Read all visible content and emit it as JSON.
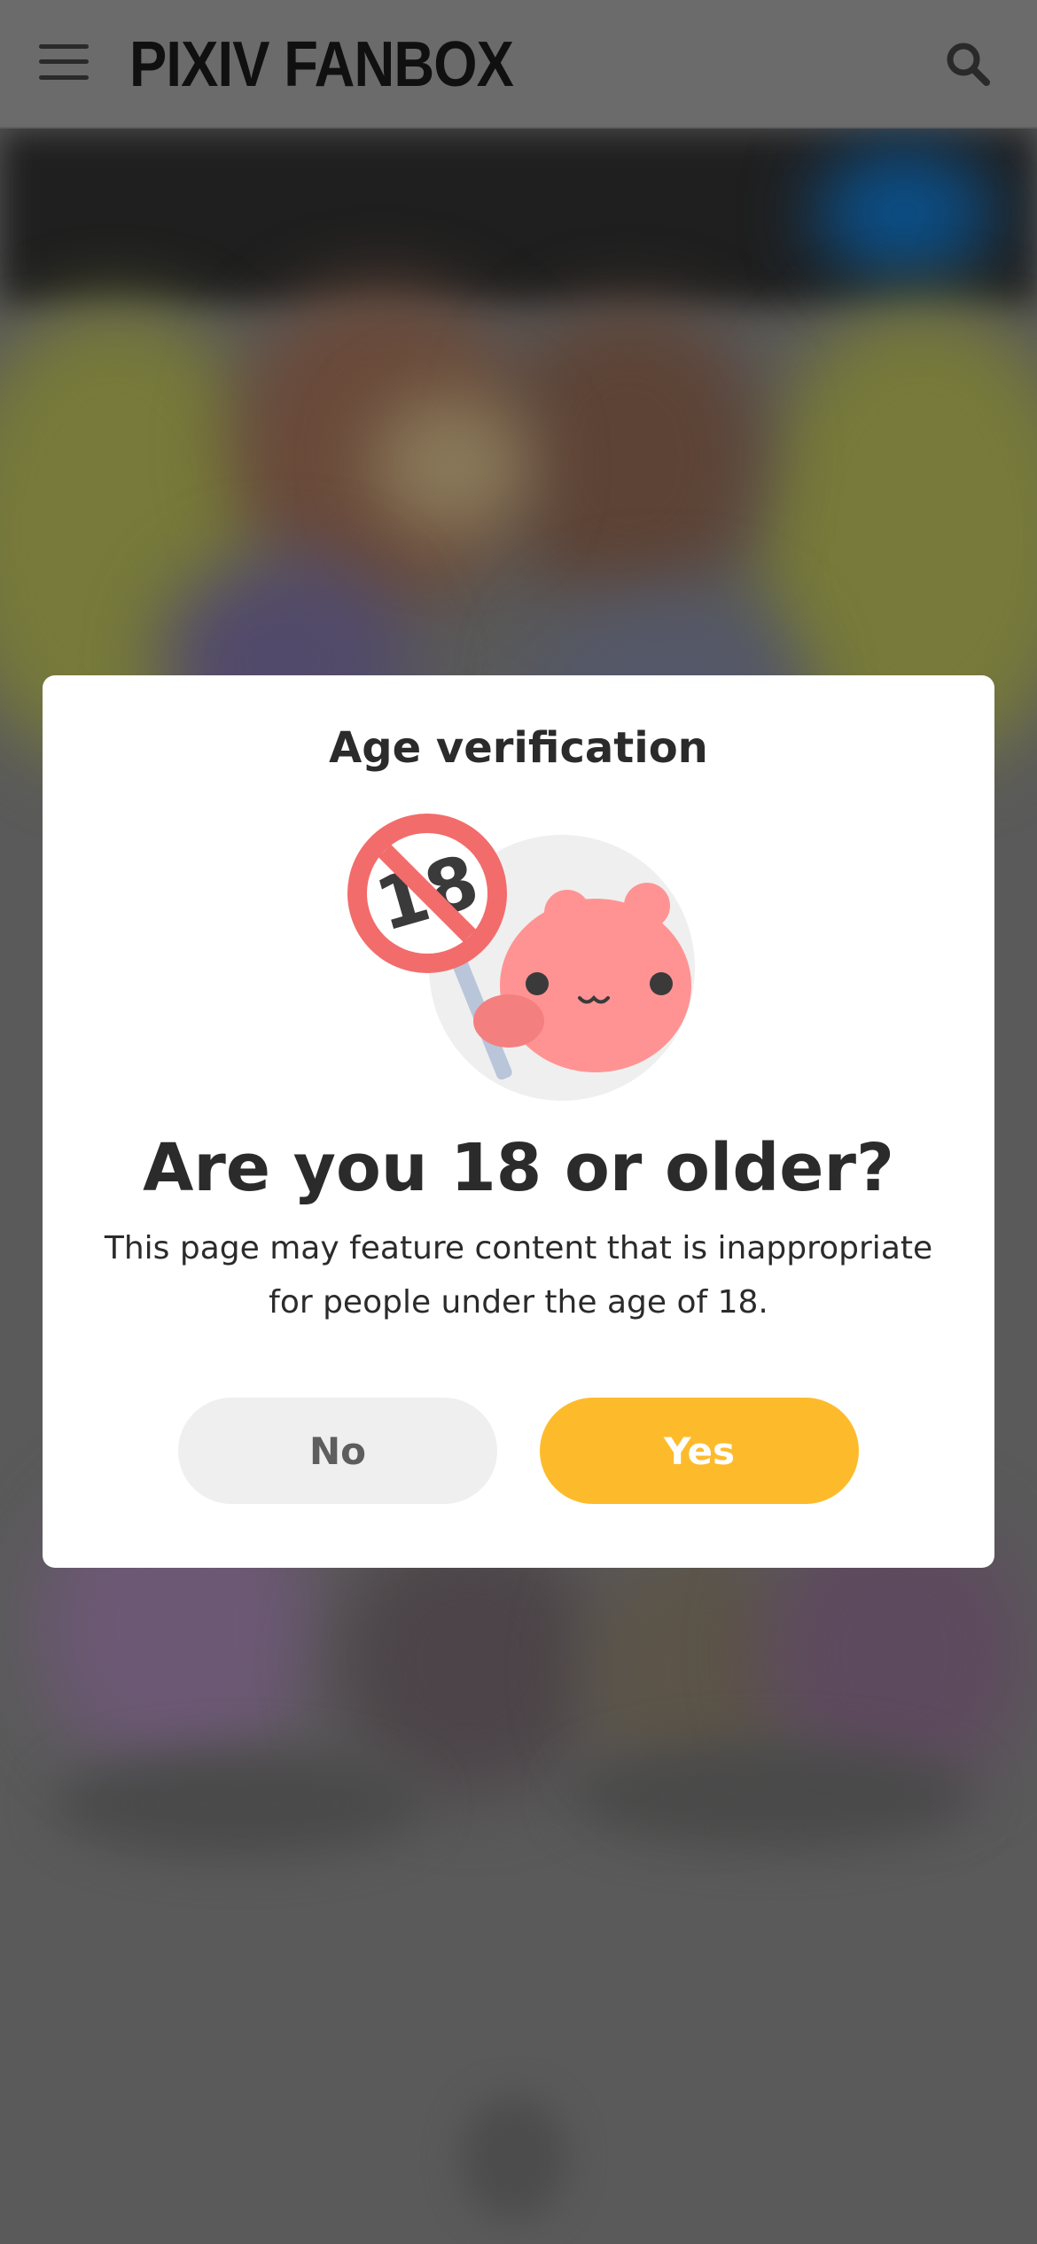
{
  "header": {
    "logo": "PIXIV FANBOX",
    "menu_icon": "hamburger-menu-icon",
    "search_icon": "search-icon"
  },
  "modal": {
    "title": "Age verification",
    "illustration": "age-restricted-18-mascot-icon",
    "question": "Are you 18 or older?",
    "description_line1": "This page may feature content that is inappropriate",
    "description_line2": "for people under the age of 18.",
    "no_label": "No",
    "yes_label": "Yes"
  },
  "colors": {
    "accent": "#fdbb2c",
    "secondary_button": "#efefef",
    "prohibition": "#f26c6c",
    "mascot": "#ff9393"
  }
}
